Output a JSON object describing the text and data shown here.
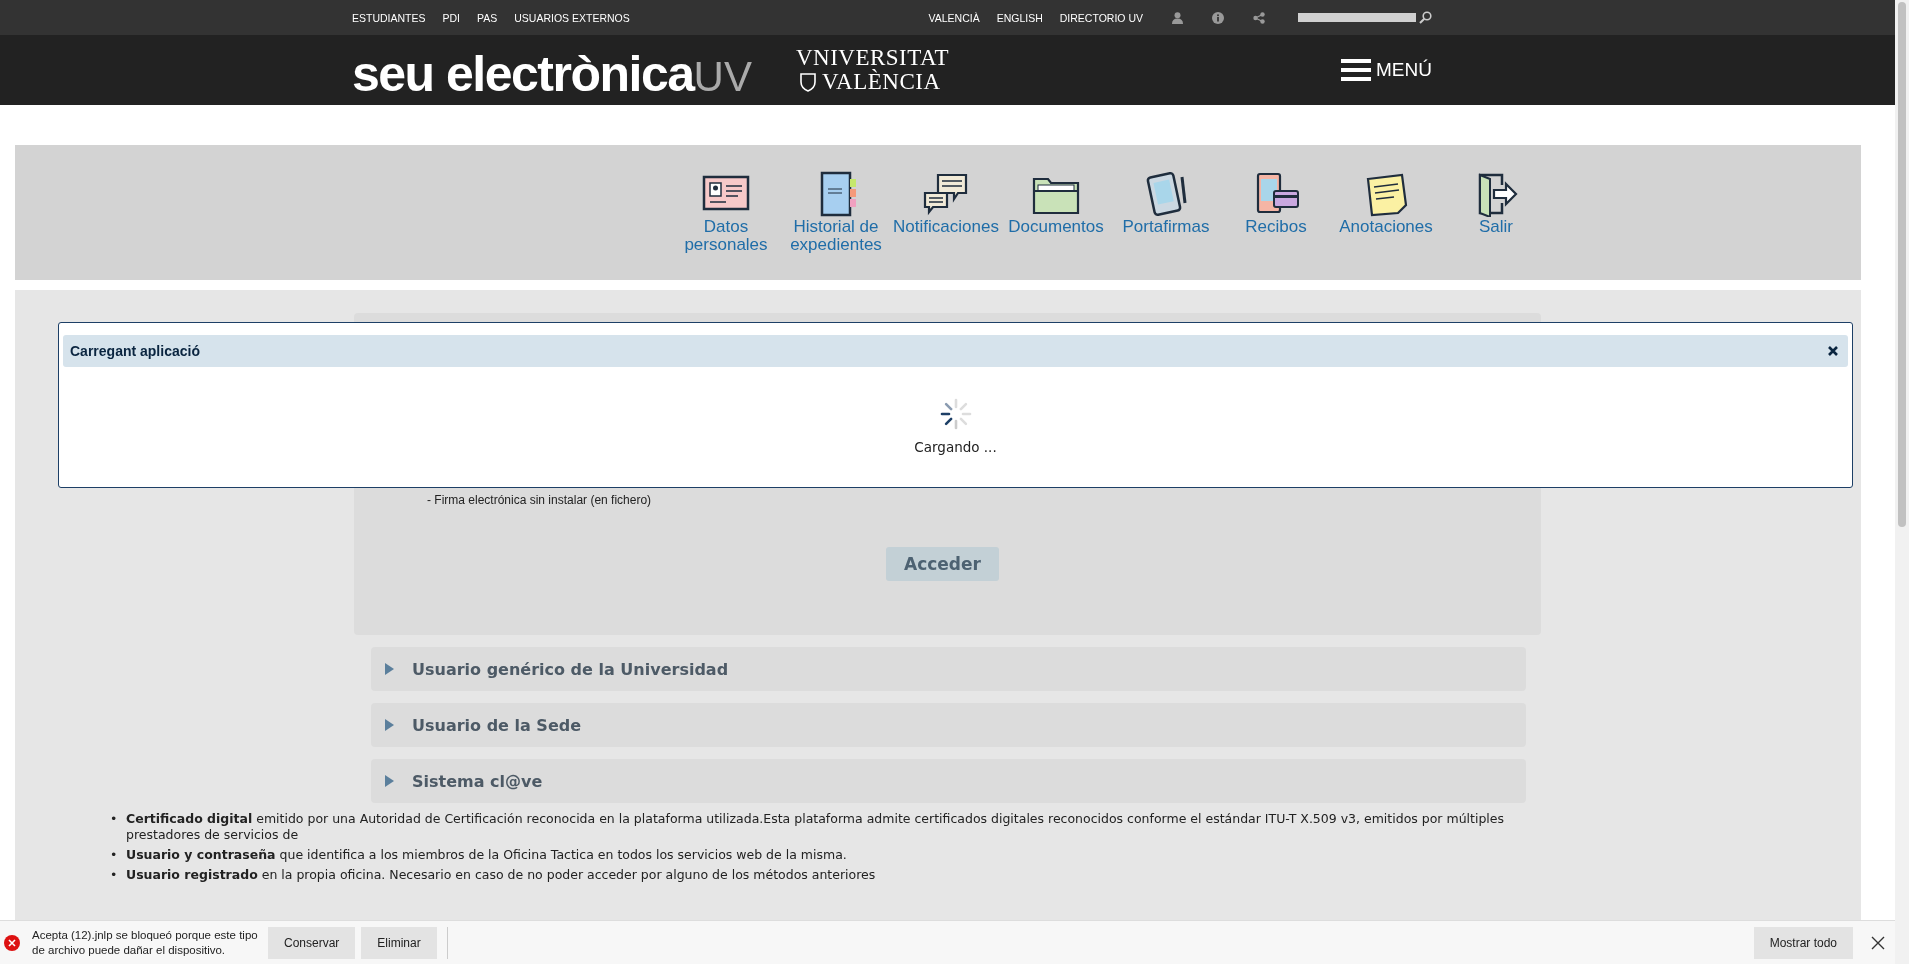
{
  "topbar": {
    "links": [
      "ESTUDIANTES",
      "PDI",
      "PAS",
      "USUARIOS EXTERNOS"
    ],
    "lang_links": [
      "VALENCIÀ",
      "ENGLISH",
      "DIRECTORIO UV"
    ]
  },
  "header": {
    "logo": "seu electrònica",
    "logo_suffix": "UV",
    "university": [
      "VNIVERSITAT",
      "VALÈNCIA"
    ],
    "menu": "MENÚ"
  },
  "apps": [
    {
      "kind": "id-card",
      "label": "Datos personales"
    },
    {
      "kind": "notebook",
      "label": "Historial de expedientes"
    },
    {
      "kind": "chat",
      "label": "Notificaciones"
    },
    {
      "kind": "folder",
      "label": "Documentos"
    },
    {
      "kind": "tablet",
      "label": "Portafirmas"
    },
    {
      "kind": "card",
      "label": "Recibos"
    },
    {
      "kind": "note",
      "label": "Anotaciones"
    },
    {
      "kind": "exit",
      "label": "Salir"
    }
  ],
  "login": {
    "note": "- Firma electrónica sin instalar (en fichero)",
    "button": "Acceder"
  },
  "sections": [
    {
      "label": "Usuario genérico de la Universidad",
      "expanded": false
    },
    {
      "label": "Usuario de la Sede",
      "expanded": false
    },
    {
      "label": "Sistema cl@ve",
      "expanded": false
    }
  ],
  "bullets": [
    {
      "marker": "•",
      "text": "**Certificado digital** emitido por una Autoridad de Certificación reconocida en la plataforma utilizada.Esta plataforma admite certificados digitales reconocidos conforme el estándar ITU-T X.509 v3, emitidos por múltiples prestadores de servicios de"
    },
    {
      "marker": "•",
      "text": "**Usuario y contraseña** que identifica a los miembros de la Oficina Tactica en todos los servicios web de la misma."
    },
    {
      "marker": "•",
      "text": "**Usuario registrado** en la propia oficina. Necesario en caso de no poder acceder por alguno de los métodos anteriores"
    }
  ],
  "modal": {
    "title": "Carregant aplicació",
    "message": "Cargando ..."
  },
  "download_bar": {
    "message": "Acepta (12).jnlp se bloqueó porque este tipo de archivo puede dañar el dispositivo.",
    "buttons": [
      "Conservar",
      "Eliminar"
    ],
    "show_all": "Mostrar todo"
  }
}
